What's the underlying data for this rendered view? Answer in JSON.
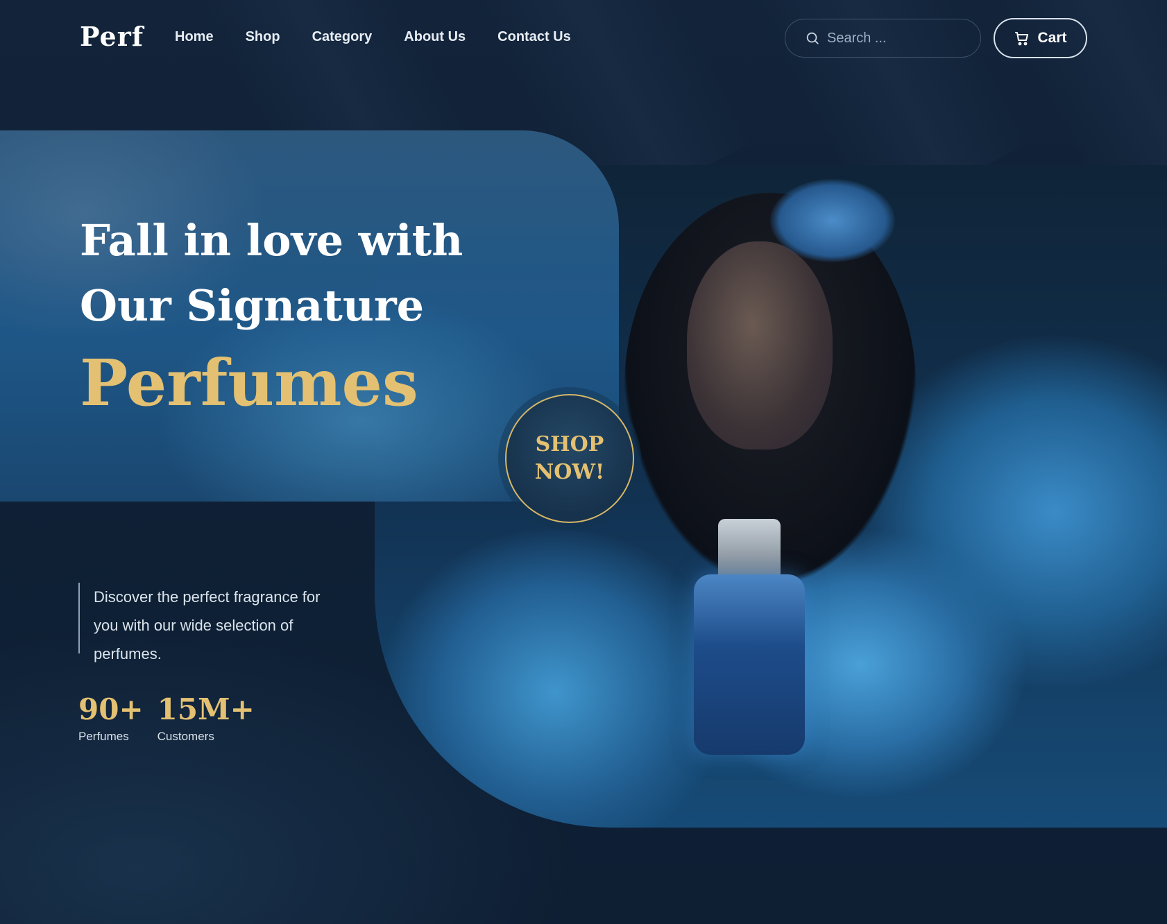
{
  "brand": {
    "logo": "Perf"
  },
  "nav": {
    "items": [
      {
        "label": "Home"
      },
      {
        "label": "Shop"
      },
      {
        "label": "Category"
      },
      {
        "label": "About Us"
      },
      {
        "label": "Contact Us"
      }
    ]
  },
  "search": {
    "placeholder": "Search ..."
  },
  "cart": {
    "label": "Cart"
  },
  "hero": {
    "line1": "Fall in love with",
    "line2": "Our Signature",
    "highlight": "Perfumes",
    "cta": "SHOP NOW!",
    "description": "Discover the perfect fragrance for you with our wide selection of perfumes."
  },
  "stats": [
    {
      "value": "90+",
      "label": "Perfumes"
    },
    {
      "value": "15M+",
      "label": "Customers"
    }
  ],
  "colors": {
    "accent_gold": "#e4c172",
    "background": "#12233a",
    "panel_blue": "#1f5a8c"
  }
}
